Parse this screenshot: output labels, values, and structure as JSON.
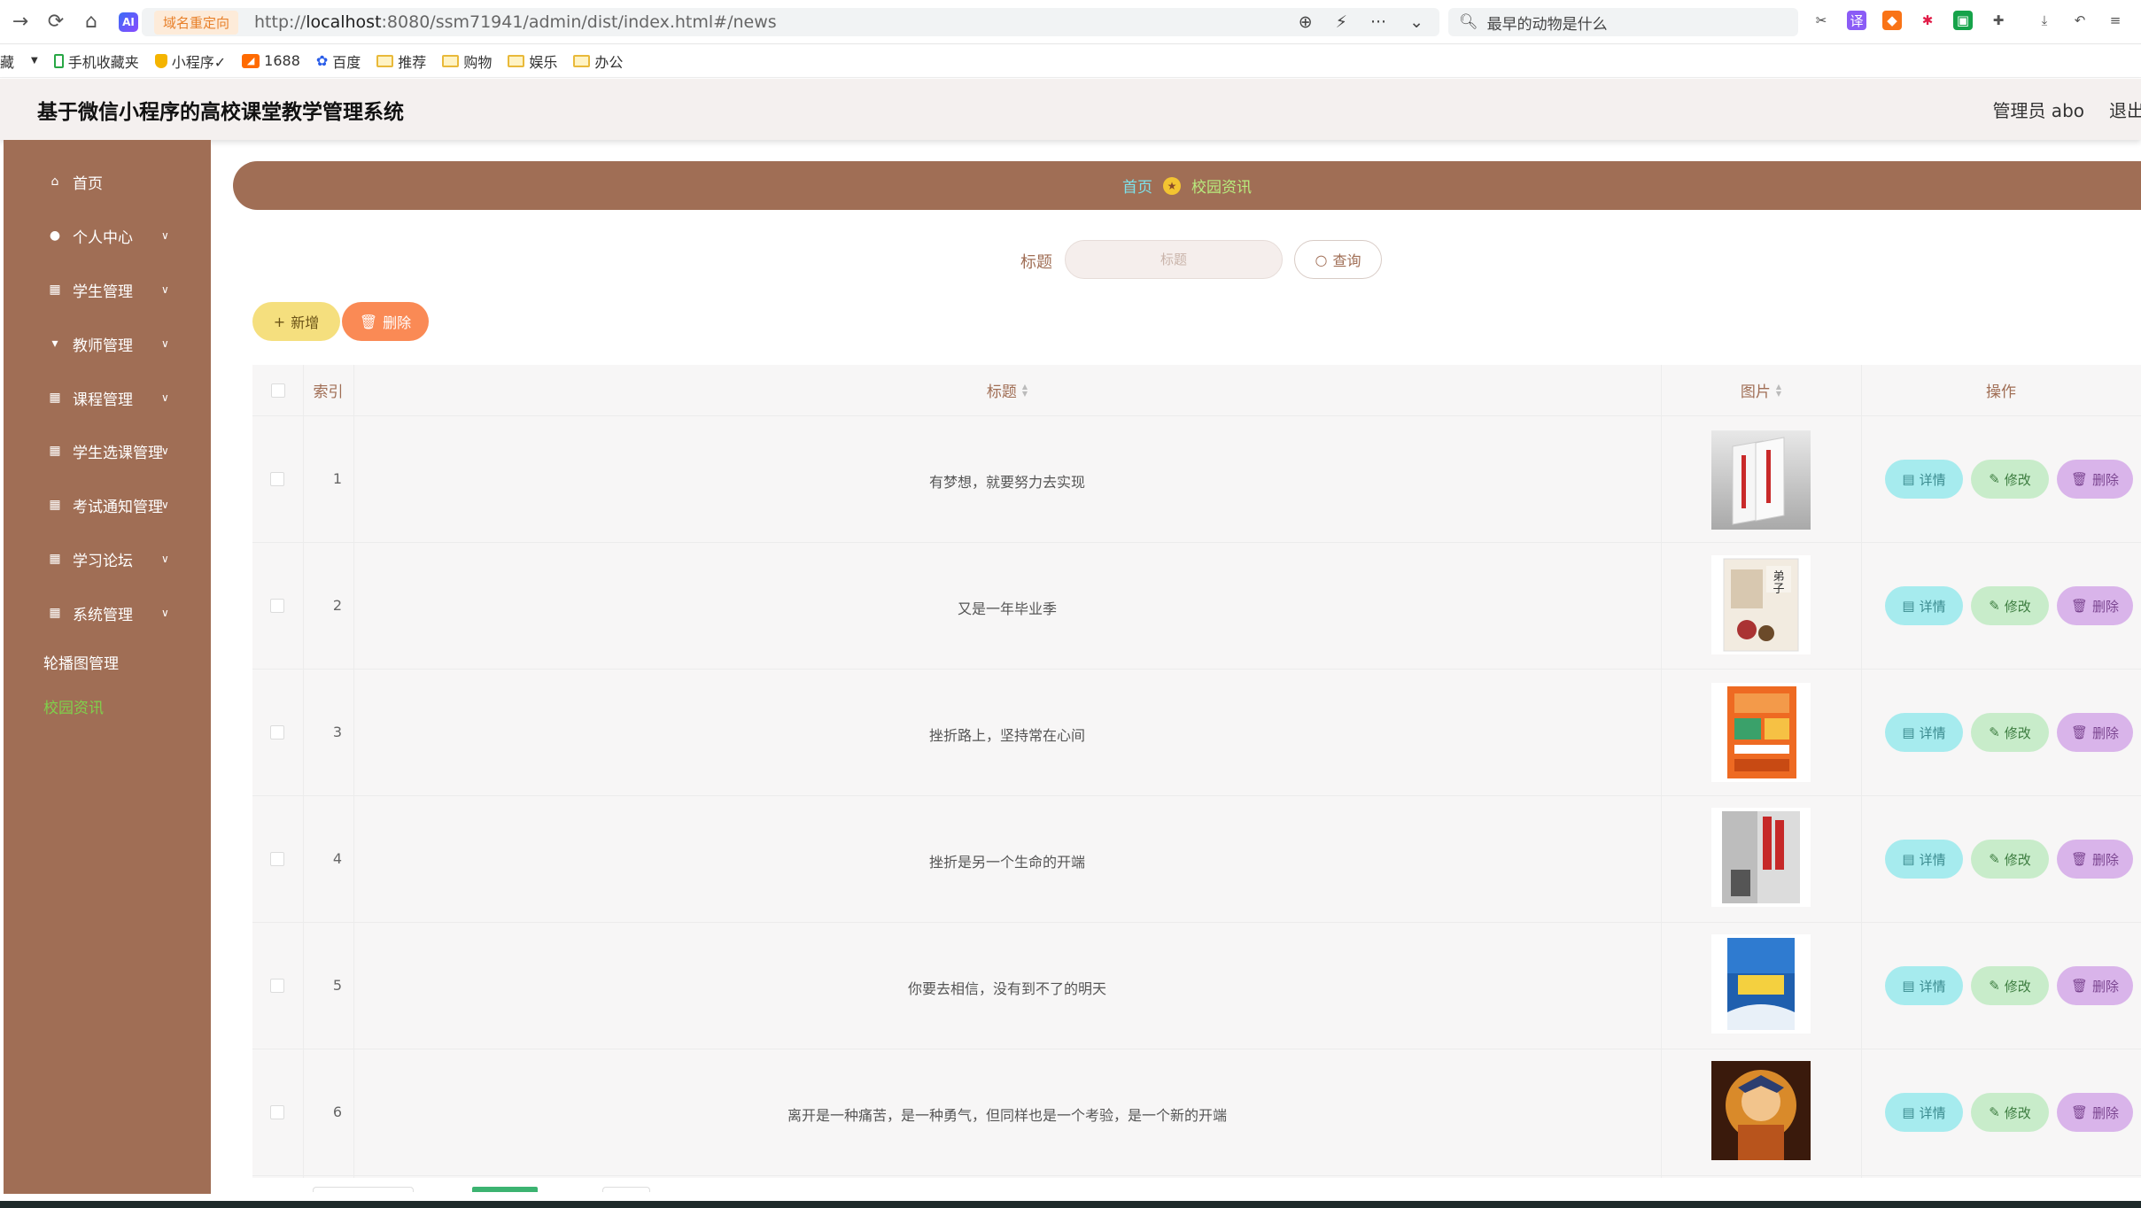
{
  "browser": {
    "redirect_tag": "域名重定向",
    "url_prefix": "http://",
    "url_host": "localhost",
    "url_rest": ":8080/ssm71941/admin/dist/index.html#/news",
    "search_text": "最早的动物是什么",
    "ai_label": "AI"
  },
  "bookmarks": [
    {
      "label": "藏",
      "icon": "bookmark-icon"
    },
    {
      "label": "手机收藏夹",
      "icon": "phone-icon"
    },
    {
      "label": "小程序✓",
      "icon": "shield-icon"
    },
    {
      "label": "1688",
      "icon": "brand-1688-icon"
    },
    {
      "label": "百度",
      "icon": "baidu-paw-icon"
    },
    {
      "label": "推荐",
      "icon": "folder-icon"
    },
    {
      "label": "购物",
      "icon": "folder-icon"
    },
    {
      "label": "娱乐",
      "icon": "folder-icon"
    },
    {
      "label": "办公",
      "icon": "folder-icon"
    }
  ],
  "header": {
    "title": "基于微信小程序的高校课堂教学管理系统",
    "user": "管理员 abo",
    "logout": "退出"
  },
  "sidebar": {
    "items": [
      {
        "label": "首页",
        "icon": "home-icon",
        "submenu": false
      },
      {
        "label": "个人中心",
        "icon": "user-icon",
        "submenu": true
      },
      {
        "label": "学生管理",
        "icon": "grid-icon",
        "submenu": true
      },
      {
        "label": "教师管理",
        "icon": "teacher-icon",
        "submenu": true
      },
      {
        "label": "课程管理",
        "icon": "grid-icon",
        "submenu": true
      },
      {
        "label": "学生选课管理",
        "icon": "grid-icon",
        "submenu": true
      },
      {
        "label": "考试通知管理",
        "icon": "grid-icon",
        "submenu": true
      },
      {
        "label": "学习论坛",
        "icon": "grid-icon",
        "submenu": true
      },
      {
        "label": "系统管理",
        "icon": "grid-icon",
        "submenu": true
      },
      {
        "label": "轮播图管理",
        "icon": "",
        "submenu": false
      },
      {
        "label": "校园资讯",
        "icon": "",
        "submenu": false
      }
    ],
    "active_label": "校园资讯"
  },
  "breadcrumb": {
    "home": "首页",
    "current": "校园资讯"
  },
  "search": {
    "label": "标题",
    "placeholder": "标题",
    "query_label": "查询"
  },
  "actions": {
    "add_label": "新增",
    "delete_label": "删除"
  },
  "table": {
    "headers": {
      "index": "索引",
      "title": "标题",
      "image": "图片",
      "ops": "操作"
    },
    "rows": [
      {
        "index": "1",
        "title": "有梦想，就要努力去实现",
        "image": "book-cover-white-red"
      },
      {
        "index": "2",
        "title": "又是一年毕业季",
        "image": "book-cover-dizigui"
      },
      {
        "index": "3",
        "title": "挫折路上，坚持常在心间",
        "image": "book-cover-orange"
      },
      {
        "index": "4",
        "title": "挫折是另一个生命的开端",
        "image": "book-cover-grey-red"
      },
      {
        "index": "5",
        "title": "你要去相信，没有到不了的明天",
        "image": "book-cover-blue"
      },
      {
        "index": "6",
        "title": "离开是一种痛苦，是一种勇气，但同样也是一个考验，是一个新的开端",
        "image": "poster-anime"
      }
    ],
    "op_labels": {
      "detail": "详情",
      "edit": "修改",
      "delete": "删除"
    }
  },
  "colors": {
    "sidebar_bg": "#a06e55",
    "active_menu": "#7fd14b",
    "detail_btn": "#a6ebee",
    "edit_btn": "#c8ecca",
    "delete_btn": "#d9b4ea",
    "add_btn": "#f5df7e",
    "batch_delete_btn": "#fa8a55"
  }
}
